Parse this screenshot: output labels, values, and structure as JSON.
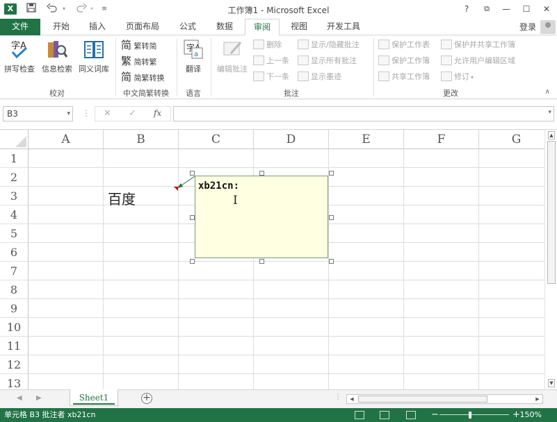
{
  "window": {
    "title": "工作簿1 - Microsoft Excel",
    "app_icon": "X",
    "controls": {
      "help": "?",
      "restore_ribbon": "⧉",
      "minimize": "—",
      "maximize": "☐",
      "close": "✕"
    }
  },
  "qat": {
    "save": "💾",
    "undo": "↶",
    "redo": "↷",
    "customize": "≡"
  },
  "tabs": [
    {
      "label": "文件"
    },
    {
      "label": "开始"
    },
    {
      "label": "插入"
    },
    {
      "label": "页面布局"
    },
    {
      "label": "公式"
    },
    {
      "label": "数据"
    },
    {
      "label": "审阅"
    },
    {
      "label": "视图"
    },
    {
      "label": "开发工具"
    }
  ],
  "account": {
    "login": "登录"
  },
  "ribbon": {
    "proofing": {
      "label": "校对",
      "spell": "拼写检查",
      "research": "信息检索",
      "thesaurus": "同义词库"
    },
    "chinese": {
      "label": "中文简繁转换",
      "to_simplified": "繁转简",
      "to_traditional": "简转繁",
      "convert": "简繁转换",
      "glyph_simplified": "简",
      "glyph_traditional": "繁",
      "glyph_convert": "简"
    },
    "language": {
      "label": "语言",
      "translate": "翻译",
      "icon_text": "字A"
    },
    "comments": {
      "label": "批注",
      "edit": "编辑批注",
      "delete": "删除",
      "previous": "上一条",
      "next": "下一条",
      "show_hide": "显示/隐藏批注",
      "show_all": "显示所有批注",
      "show_ink": "显示墨迹"
    },
    "changes": {
      "label": "更改",
      "protect_sheet": "保护工作表",
      "protect_workbook": "保护工作簿",
      "share_workbook": "共享工作簿",
      "protect_share": "保护并共享工作簿",
      "allow_edit_ranges": "允许用户编辑区域",
      "track_changes": "修订"
    }
  },
  "formula_bar": {
    "name_box": "B3",
    "cancel": "✕",
    "enter": "✓",
    "fx": "fx",
    "value": ""
  },
  "grid": {
    "columns": [
      "A",
      "B",
      "C",
      "D",
      "E",
      "F",
      "G"
    ],
    "rows": [
      "1",
      "2",
      "3",
      "4",
      "5",
      "6",
      "7",
      "8",
      "9",
      "10",
      "11",
      "12",
      "13"
    ],
    "cells": {
      "B3": "百度"
    }
  },
  "comment": {
    "text": "xb21cn:",
    "cursor": "I"
  },
  "sheets": [
    {
      "label": "Sheet1"
    }
  ],
  "status": {
    "text": "单元格 B3 批注者 xb21cn",
    "zoom": "150%",
    "zoom_minus": "−",
    "zoom_plus": "+"
  },
  "colors": {
    "accent": "#217346",
    "comment_bg": "#ffffe1",
    "comment_flag": "#dd0000"
  }
}
